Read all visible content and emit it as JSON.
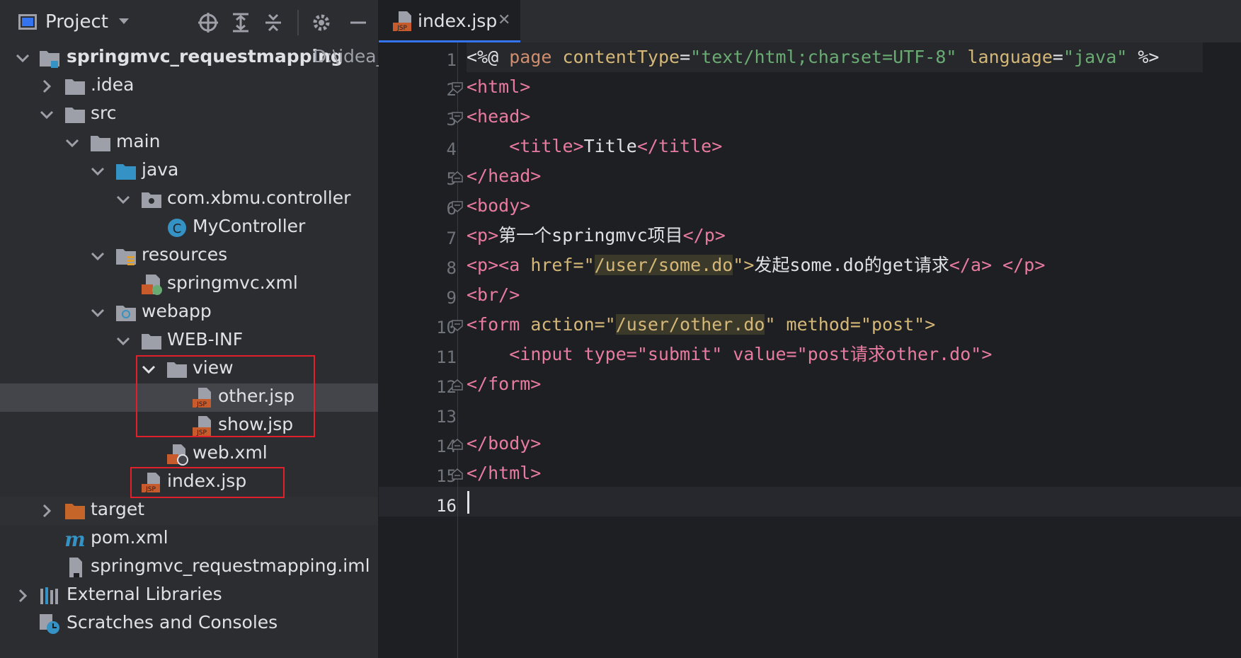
{
  "sidebar": {
    "title": "Project",
    "items": [
      {
        "label": "springmvc_requestmapping",
        "path": "D:\\idea_",
        "bold": true
      },
      {
        "label": ".idea"
      },
      {
        "label": "src"
      },
      {
        "label": "main"
      },
      {
        "label": "java"
      },
      {
        "label": "com.xbmu.controller"
      },
      {
        "label": "MyController",
        "icon_letter": "C"
      },
      {
        "label": "resources"
      },
      {
        "label": "springmvc.xml"
      },
      {
        "label": "webapp"
      },
      {
        "label": "WEB-INF"
      },
      {
        "label": "view"
      },
      {
        "label": "other.jsp"
      },
      {
        "label": "show.jsp"
      },
      {
        "label": "web.xml"
      },
      {
        "label": "index.jsp"
      },
      {
        "label": "target"
      },
      {
        "label": "pom.xml",
        "icon_letter": "m"
      },
      {
        "label": "springmvc_requestmapping.iml"
      },
      {
        "label": "External Libraries"
      },
      {
        "label": "Scratches and Consoles"
      }
    ]
  },
  "editor": {
    "tab": {
      "label": "index.jsp",
      "icon_text": "JSP"
    },
    "line_numbers": [
      "1",
      "2",
      "3",
      "4",
      "5",
      "6",
      "7",
      "8",
      "9",
      "10",
      "11",
      "12",
      "13",
      "14",
      "15",
      "16"
    ],
    "code": {
      "l1": {
        "open": "<%@ ",
        "page": "page",
        "sp1": " ",
        "ct": "contentType",
        "eq1": "=",
        "ctv": "\"text/html;charset=UTF-8\"",
        "sp2": " ",
        "lang": "language",
        "eq2": "=",
        "langv": "\"java\"",
        "close": " %>"
      },
      "l2": "<html>",
      "l3": "<head>",
      "l4": {
        "indent": "    ",
        "open": "<title>",
        "text": "Title",
        "close": "</title>"
      },
      "l5": "</head>",
      "l6": "<body>",
      "l7": {
        "open": "<p>",
        "text": "第一个springmvc项目",
        "close": "</p>"
      },
      "l8": {
        "open": "<p><a ",
        "attr": "href=\"",
        "href": "/user/some.do",
        "end": "\">",
        "text": "发起some.do的get请求",
        "close": "</a> </p>"
      },
      "l9": "<br/>",
      "l10": {
        "open": "<form ",
        "attr": "action=\"",
        "action": "/user/other.do",
        "rest": "\" method=\"post\">"
      },
      "l11": {
        "indent": "    ",
        "text": "<input type=\"submit\" value=\"post请求other.do\">"
      },
      "l12": "</form>",
      "l13": "",
      "l14": "</body>",
      "l15": "</html>",
      "l16": ""
    }
  },
  "colors": {
    "highlight_box": "#e0202a",
    "accent": "#3574f0"
  }
}
